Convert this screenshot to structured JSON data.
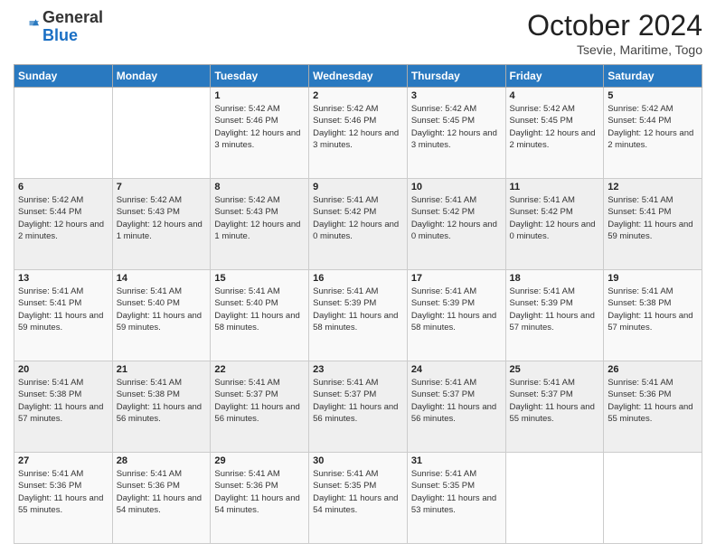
{
  "header": {
    "logo": {
      "line1": "General",
      "line2": "Blue"
    },
    "title": "October 2024",
    "subtitle": "Tsevie, Maritime, Togo"
  },
  "weekdays": [
    "Sunday",
    "Monday",
    "Tuesday",
    "Wednesday",
    "Thursday",
    "Friday",
    "Saturday"
  ],
  "weeks": [
    [
      {
        "day": "",
        "info": ""
      },
      {
        "day": "",
        "info": ""
      },
      {
        "day": "1",
        "info": "Sunrise: 5:42 AM\nSunset: 5:46 PM\nDaylight: 12 hours and 3 minutes."
      },
      {
        "day": "2",
        "info": "Sunrise: 5:42 AM\nSunset: 5:46 PM\nDaylight: 12 hours and 3 minutes."
      },
      {
        "day": "3",
        "info": "Sunrise: 5:42 AM\nSunset: 5:45 PM\nDaylight: 12 hours and 3 minutes."
      },
      {
        "day": "4",
        "info": "Sunrise: 5:42 AM\nSunset: 5:45 PM\nDaylight: 12 hours and 2 minutes."
      },
      {
        "day": "5",
        "info": "Sunrise: 5:42 AM\nSunset: 5:44 PM\nDaylight: 12 hours and 2 minutes."
      }
    ],
    [
      {
        "day": "6",
        "info": "Sunrise: 5:42 AM\nSunset: 5:44 PM\nDaylight: 12 hours and 2 minutes."
      },
      {
        "day": "7",
        "info": "Sunrise: 5:42 AM\nSunset: 5:43 PM\nDaylight: 12 hours and 1 minute."
      },
      {
        "day": "8",
        "info": "Sunrise: 5:42 AM\nSunset: 5:43 PM\nDaylight: 12 hours and 1 minute."
      },
      {
        "day": "9",
        "info": "Sunrise: 5:41 AM\nSunset: 5:42 PM\nDaylight: 12 hours and 0 minutes."
      },
      {
        "day": "10",
        "info": "Sunrise: 5:41 AM\nSunset: 5:42 PM\nDaylight: 12 hours and 0 minutes."
      },
      {
        "day": "11",
        "info": "Sunrise: 5:41 AM\nSunset: 5:42 PM\nDaylight: 12 hours and 0 minutes."
      },
      {
        "day": "12",
        "info": "Sunrise: 5:41 AM\nSunset: 5:41 PM\nDaylight: 11 hours and 59 minutes."
      }
    ],
    [
      {
        "day": "13",
        "info": "Sunrise: 5:41 AM\nSunset: 5:41 PM\nDaylight: 11 hours and 59 minutes."
      },
      {
        "day": "14",
        "info": "Sunrise: 5:41 AM\nSunset: 5:40 PM\nDaylight: 11 hours and 59 minutes."
      },
      {
        "day": "15",
        "info": "Sunrise: 5:41 AM\nSunset: 5:40 PM\nDaylight: 11 hours and 58 minutes."
      },
      {
        "day": "16",
        "info": "Sunrise: 5:41 AM\nSunset: 5:39 PM\nDaylight: 11 hours and 58 minutes."
      },
      {
        "day": "17",
        "info": "Sunrise: 5:41 AM\nSunset: 5:39 PM\nDaylight: 11 hours and 58 minutes."
      },
      {
        "day": "18",
        "info": "Sunrise: 5:41 AM\nSunset: 5:39 PM\nDaylight: 11 hours and 57 minutes."
      },
      {
        "day": "19",
        "info": "Sunrise: 5:41 AM\nSunset: 5:38 PM\nDaylight: 11 hours and 57 minutes."
      }
    ],
    [
      {
        "day": "20",
        "info": "Sunrise: 5:41 AM\nSunset: 5:38 PM\nDaylight: 11 hours and 57 minutes."
      },
      {
        "day": "21",
        "info": "Sunrise: 5:41 AM\nSunset: 5:38 PM\nDaylight: 11 hours and 56 minutes."
      },
      {
        "day": "22",
        "info": "Sunrise: 5:41 AM\nSunset: 5:37 PM\nDaylight: 11 hours and 56 minutes."
      },
      {
        "day": "23",
        "info": "Sunrise: 5:41 AM\nSunset: 5:37 PM\nDaylight: 11 hours and 56 minutes."
      },
      {
        "day": "24",
        "info": "Sunrise: 5:41 AM\nSunset: 5:37 PM\nDaylight: 11 hours and 56 minutes."
      },
      {
        "day": "25",
        "info": "Sunrise: 5:41 AM\nSunset: 5:37 PM\nDaylight: 11 hours and 55 minutes."
      },
      {
        "day": "26",
        "info": "Sunrise: 5:41 AM\nSunset: 5:36 PM\nDaylight: 11 hours and 55 minutes."
      }
    ],
    [
      {
        "day": "27",
        "info": "Sunrise: 5:41 AM\nSunset: 5:36 PM\nDaylight: 11 hours and 55 minutes."
      },
      {
        "day": "28",
        "info": "Sunrise: 5:41 AM\nSunset: 5:36 PM\nDaylight: 11 hours and 54 minutes."
      },
      {
        "day": "29",
        "info": "Sunrise: 5:41 AM\nSunset: 5:36 PM\nDaylight: 11 hours and 54 minutes."
      },
      {
        "day": "30",
        "info": "Sunrise: 5:41 AM\nSunset: 5:35 PM\nDaylight: 11 hours and 54 minutes."
      },
      {
        "day": "31",
        "info": "Sunrise: 5:41 AM\nSunset: 5:35 PM\nDaylight: 11 hours and 53 minutes."
      },
      {
        "day": "",
        "info": ""
      },
      {
        "day": "",
        "info": ""
      }
    ]
  ]
}
